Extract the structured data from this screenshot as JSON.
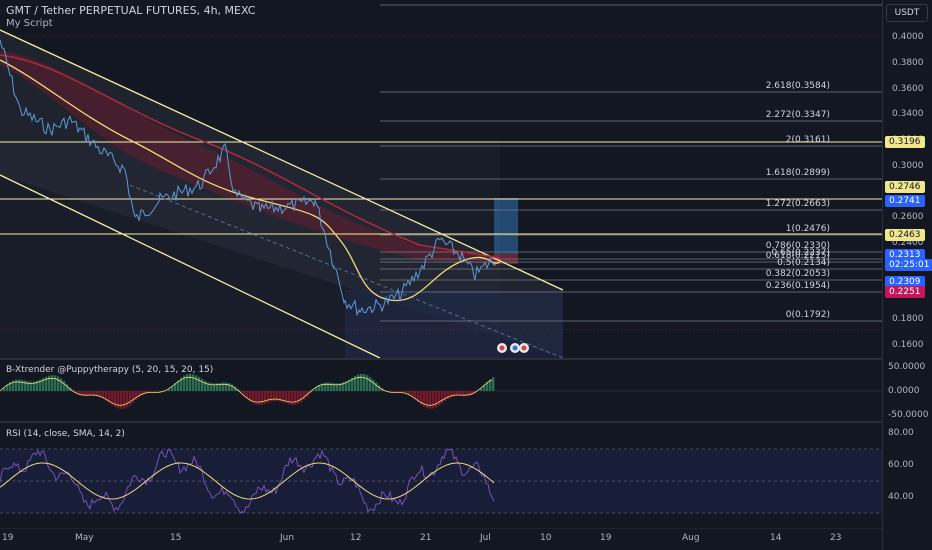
{
  "header": {
    "symbol_title": "GMT / Tether PERPETUAL FUTURES, 4h, MEXC",
    "script_name": "My Script"
  },
  "price_axis": {
    "currency": "USDT",
    "ticks": [
      "0.4000",
      "0.3800",
      "0.3600",
      "0.3400",
      "0.3200",
      "0.3000",
      "0.2800",
      "0.2600",
      "0.2400",
      "0.2200",
      "0.2000",
      "0.1800",
      "0.1600"
    ]
  },
  "fib_levels": [
    {
      "label": "2.618(0.3584)"
    },
    {
      "label": "2.272(0.3347)"
    },
    {
      "label": "2(0.3161)"
    },
    {
      "label": "1.618(0.2899)"
    },
    {
      "label": "1.272(0.2663)"
    },
    {
      "label": "1(0.2476)"
    },
    {
      "label": "0.786(0.2330)"
    },
    {
      "label": "0.65(0.2237)"
    },
    {
      "label": "0.618(0.2215)"
    },
    {
      "label": "0.5(0.2134)"
    },
    {
      "label": "0.382(0.2053)"
    },
    {
      "label": "0.236(0.1954)"
    },
    {
      "label": "0(0.1792)"
    }
  ],
  "price_tags": [
    {
      "text": "0.3196",
      "bg": "#f0e68c",
      "fg": "#131722"
    },
    {
      "text": "0.2746",
      "bg": "#f0e68c",
      "fg": "#131722"
    },
    {
      "text": "0.2741",
      "bg": "#2962ff",
      "fg": "#ffffff"
    },
    {
      "text": "0.2463",
      "bg": "#f0e68c",
      "fg": "#131722"
    },
    {
      "text": "0.2313",
      "bg": "#2962ff",
      "fg": "#ffffff"
    },
    {
      "text": "02:25:01",
      "bg": "#2962ff",
      "fg": "#ffffff"
    },
    {
      "text": "0.2309",
      "bg": "#2962ff",
      "fg": "#ffffff"
    },
    {
      "text": "0.2251",
      "bg": "#c2185b",
      "fg": "#ffffff"
    }
  ],
  "xtrender": {
    "title": "B-Xtrender @Puppytherapy (5, 20, 15, 20, 15)",
    "ticks": [
      "50.0000",
      "0.0000",
      "-50.0000"
    ]
  },
  "rsi": {
    "title": "RSI (14, close, SMA, 14, 2)",
    "ticks": [
      "80.00",
      "60.00",
      "40.00"
    ]
  },
  "time_axis": {
    "labels": [
      "19",
      "May",
      "15",
      "Jun",
      "12",
      "21",
      "Jul",
      "10",
      "19",
      "Aug",
      "14",
      "23"
    ]
  },
  "colors": {
    "background": "#131722",
    "channel": "#f5eea0",
    "ema_red": "#b2283a",
    "ema_yellow": "#f0d97a",
    "price_line": "#5b9bd5",
    "fib_line": "#787b86"
  }
}
